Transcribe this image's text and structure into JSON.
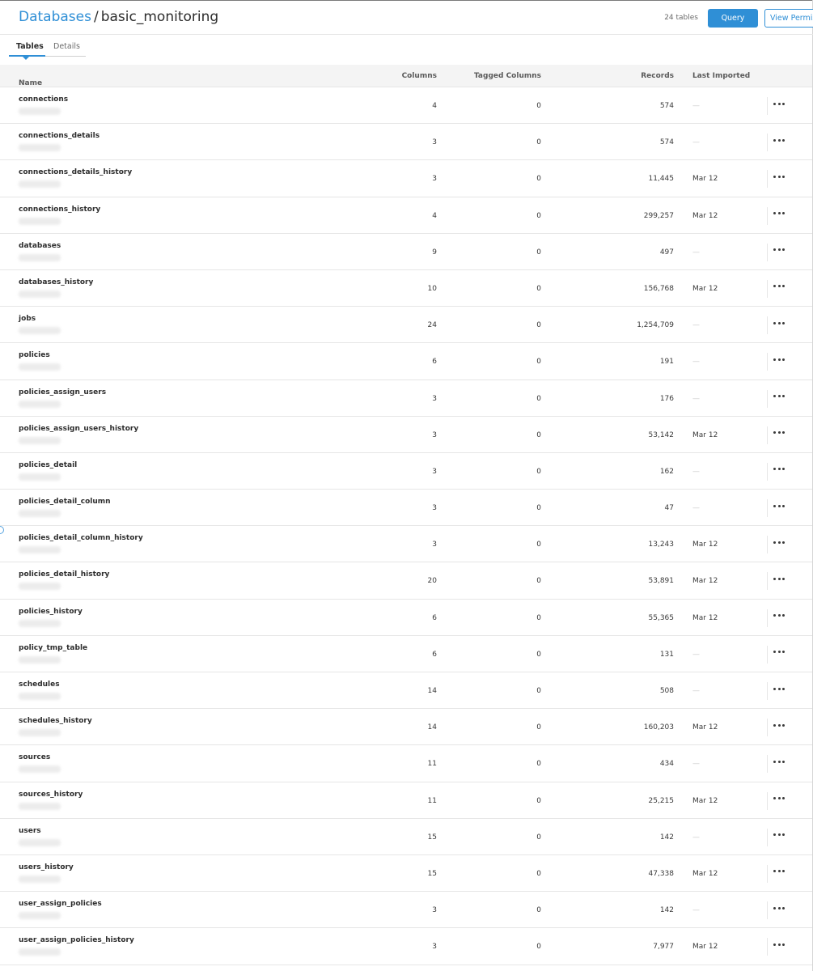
{
  "header": {
    "breadcrumb_root": "Databases",
    "breadcrumb_sep": "/",
    "breadcrumb_current": "basic_monitoring",
    "table_count": "24 tables",
    "query_label": "Query",
    "permissions_label": "View Permissions"
  },
  "tabs": [
    {
      "label": "Tables",
      "active": true
    },
    {
      "label": "Details",
      "active": false
    }
  ],
  "columns": {
    "name": "Name",
    "columns": "Columns",
    "tagged": "Tagged Columns",
    "records": "Records",
    "imported": "Last Imported"
  },
  "colors": {
    "accent": "#2f8fd6",
    "header_bg": "#f4f4f4"
  },
  "rows": [
    {
      "name": "connections",
      "columns": "4",
      "tagged": "0",
      "records": "574",
      "imported": "—"
    },
    {
      "name": "connections_details",
      "columns": "3",
      "tagged": "0",
      "records": "574",
      "imported": "—"
    },
    {
      "name": "connections_details_history",
      "columns": "3",
      "tagged": "0",
      "records": "11,445",
      "imported": "Mar 12"
    },
    {
      "name": "connections_history",
      "columns": "4",
      "tagged": "0",
      "records": "299,257",
      "imported": "Mar 12"
    },
    {
      "name": "databases",
      "columns": "9",
      "tagged": "0",
      "records": "497",
      "imported": "—"
    },
    {
      "name": "databases_history",
      "columns": "10",
      "tagged": "0",
      "records": "156,768",
      "imported": "Mar 12"
    },
    {
      "name": "jobs",
      "columns": "24",
      "tagged": "0",
      "records": "1,254,709",
      "imported": "—"
    },
    {
      "name": "policies",
      "columns": "6",
      "tagged": "0",
      "records": "191",
      "imported": "—"
    },
    {
      "name": "policies_assign_users",
      "columns": "3",
      "tagged": "0",
      "records": "176",
      "imported": "—"
    },
    {
      "name": "policies_assign_users_history",
      "columns": "3",
      "tagged": "0",
      "records": "53,142",
      "imported": "Mar 12"
    },
    {
      "name": "policies_detail",
      "columns": "3",
      "tagged": "0",
      "records": "162",
      "imported": "—"
    },
    {
      "name": "policies_detail_column",
      "columns": "3",
      "tagged": "0",
      "records": "47",
      "imported": "—"
    },
    {
      "name": "policies_detail_column_history",
      "columns": "3",
      "tagged": "0",
      "records": "13,243",
      "imported": "Mar 12"
    },
    {
      "name": "policies_detail_history",
      "columns": "20",
      "tagged": "0",
      "records": "53,891",
      "imported": "Mar 12"
    },
    {
      "name": "policies_history",
      "columns": "6",
      "tagged": "0",
      "records": "55,365",
      "imported": "Mar 12"
    },
    {
      "name": "policy_tmp_table",
      "columns": "6",
      "tagged": "0",
      "records": "131",
      "imported": "—"
    },
    {
      "name": "schedules",
      "columns": "14",
      "tagged": "0",
      "records": "508",
      "imported": "—"
    },
    {
      "name": "schedules_history",
      "columns": "14",
      "tagged": "0",
      "records": "160,203",
      "imported": "Mar 12"
    },
    {
      "name": "sources",
      "columns": "11",
      "tagged": "0",
      "records": "434",
      "imported": "—"
    },
    {
      "name": "sources_history",
      "columns": "11",
      "tagged": "0",
      "records": "25,215",
      "imported": "Mar 12"
    },
    {
      "name": "users",
      "columns": "15",
      "tagged": "0",
      "records": "142",
      "imported": "—"
    },
    {
      "name": "users_history",
      "columns": "15",
      "tagged": "0",
      "records": "47,338",
      "imported": "Mar 12"
    },
    {
      "name": "user_assign_policies",
      "columns": "3",
      "tagged": "0",
      "records": "142",
      "imported": "—"
    },
    {
      "name": "user_assign_policies_history",
      "columns": "3",
      "tagged": "0",
      "records": "7,977",
      "imported": "Mar 12"
    }
  ]
}
